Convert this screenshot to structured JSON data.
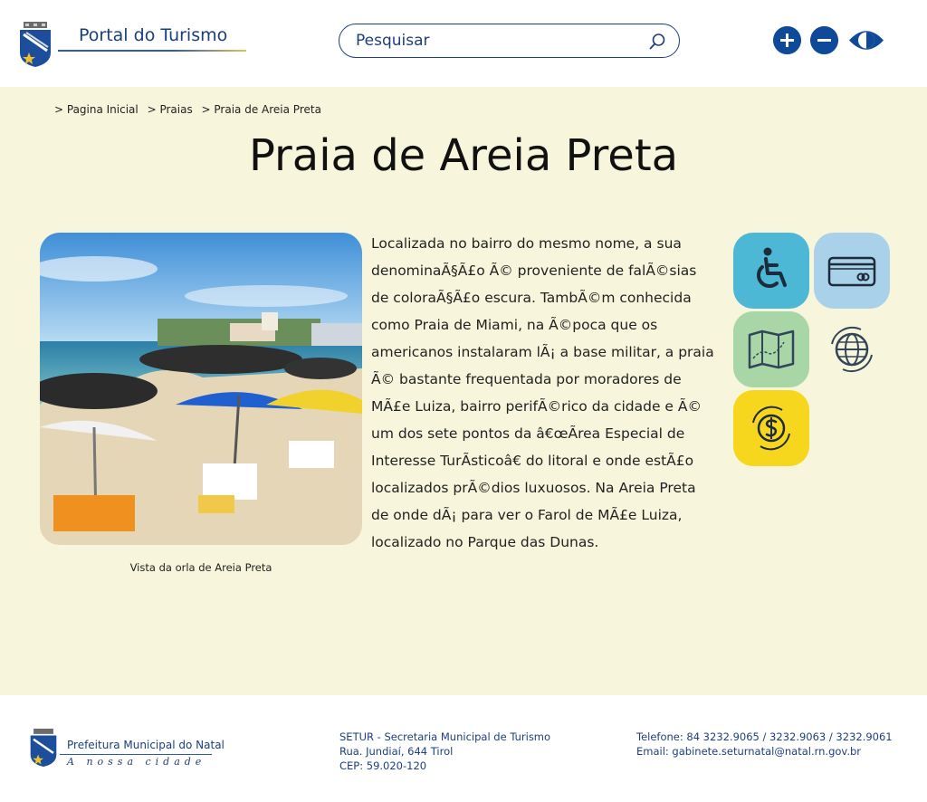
{
  "header": {
    "portal_title": "Portal do Turismo",
    "search_placeholder": "Pesquisar",
    "accessibility": {
      "increase_font": "increase-font-icon",
      "decrease_font": "decrease-font-icon",
      "contrast": "contrast-eye-icon"
    }
  },
  "breadcrumb": [
    "> Pagina Inicial",
    "> Praias",
    "> Praia de Areia Preta"
  ],
  "page": {
    "title": "Praia de Areia Preta",
    "image_caption": "Vista da orla de Areia Preta",
    "description_lines": [
      "Localizada no bairro do mesmo nome, a sua",
      "denominaÃ§Ã£o Ã© proveniente de falÃ©sias",
      "de coloraÃ§Ã£o escura. TambÃ©m conhecida",
      "como Praia de Miami, na Ã©poca que os",
      "americanos instalaram lÃ¡ a base militar, a praia",
      "Ã© bastante frequentada por moradores de",
      "MÃ£e Luiza, bairro perifÃ©rico da cidade e Ã©",
      "um dos sete pontos da â€œÃrea Especial de",
      "Interesse TurÃsticoâ€ do litoral e onde estÃ£o",
      "localizados prÃ©dios luxuosos. Na Areia Preta",
      "de onde dÃ¡ para ver o Farol de MÃ£e Luiza,",
      "localizado no Parque das Dunas."
    ]
  },
  "feature_icons": [
    {
      "name": "wheelchair-accessibility-icon",
      "color": "#4cb8d6"
    },
    {
      "name": "credit-card-icon",
      "color": "#a9d1ea"
    },
    {
      "name": "map-icon",
      "color": "#a8d6a6"
    },
    {
      "name": "globe-icon",
      "color": "#f7f6dc"
    },
    {
      "name": "currency-exchange-icon",
      "color": "#f7d61e"
    }
  ],
  "footer": {
    "org_name": "Prefeitura Municipal do Natal",
    "motto": "A nossa cidade",
    "address": [
      "SETUR - Secretaria Municipal de Turismo",
      "Rua. Jundiaí, 644 Tirol",
      "CEP: 59.020-120"
    ],
    "contact": [
      "Telefone: 84 3232.9065 / 3232.9063 / 3232.9061",
      "Email: gabinete.seturnatal@natal.rn.gov.br"
    ]
  },
  "colors": {
    "brand_blue": "#1d3f7d",
    "main_background": "#f7f6dc",
    "accent_gold": "#e0c35a"
  }
}
